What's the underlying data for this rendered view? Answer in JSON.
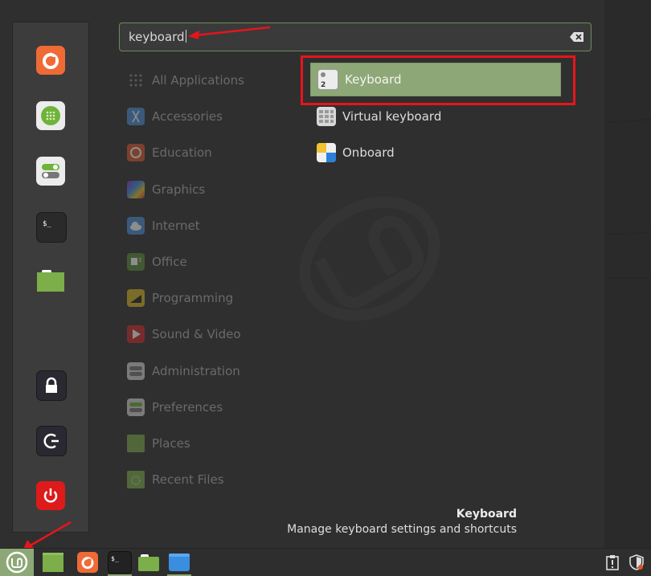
{
  "search": {
    "value": "keyboard",
    "clear_icon": "clear-text-icon"
  },
  "favorites": [
    {
      "name": "firefox",
      "icon": "firefox-icon"
    },
    {
      "name": "software-manager",
      "icon": "software-manager-icon"
    },
    {
      "name": "system-settings",
      "icon": "system-settings-icon"
    },
    {
      "name": "terminal",
      "icon": "terminal-icon"
    },
    {
      "name": "files",
      "icon": "folder-icon"
    }
  ],
  "session_buttons": [
    {
      "name": "lock-screen",
      "icon": "lock-icon"
    },
    {
      "name": "logout",
      "icon": "logout-icon"
    },
    {
      "name": "quit",
      "icon": "power-icon"
    }
  ],
  "categories": [
    {
      "label": "All Applications",
      "icon": "grid-icon"
    },
    {
      "label": "Accessories",
      "icon": "accessories-icon"
    },
    {
      "label": "Education",
      "icon": "education-icon"
    },
    {
      "label": "Graphics",
      "icon": "graphics-icon"
    },
    {
      "label": "Internet",
      "icon": "internet-icon"
    },
    {
      "label": "Office",
      "icon": "office-icon"
    },
    {
      "label": "Programming",
      "icon": "programming-icon"
    },
    {
      "label": "Sound & Video",
      "icon": "sound-video-icon"
    },
    {
      "label": "Administration",
      "icon": "administration-icon"
    },
    {
      "label": "Preferences",
      "icon": "preferences-icon"
    },
    {
      "label": "Places",
      "icon": "places-icon"
    },
    {
      "label": "Recent Files",
      "icon": "recent-files-icon"
    }
  ],
  "results": [
    {
      "label": "Keyboard",
      "icon": "keyboard-icon",
      "selected": true
    },
    {
      "label": "Virtual keyboard",
      "icon": "virtual-keyboard-icon",
      "selected": false
    },
    {
      "label": "Onboard",
      "icon": "onboard-icon",
      "selected": false
    }
  ],
  "description": {
    "title": "Keyboard",
    "text": "Manage keyboard settings and shortcuts"
  },
  "taskbar": {
    "items": [
      {
        "name": "menu",
        "icon": "mint-logo-icon"
      },
      {
        "name": "show-desktop",
        "icon": "show-desktop-icon"
      },
      {
        "name": "firefox",
        "icon": "firefox-icon"
      },
      {
        "name": "terminal",
        "icon": "terminal-icon"
      },
      {
        "name": "files",
        "icon": "folder-icon"
      },
      {
        "name": "window",
        "icon": "blue-window-icon"
      }
    ],
    "tray": [
      {
        "name": "update-manager",
        "icon": "clipboard-alert-icon"
      },
      {
        "name": "security",
        "icon": "shield-icon"
      }
    ]
  },
  "colors": {
    "accent": "#8da876",
    "annotation": "#e8141c"
  }
}
